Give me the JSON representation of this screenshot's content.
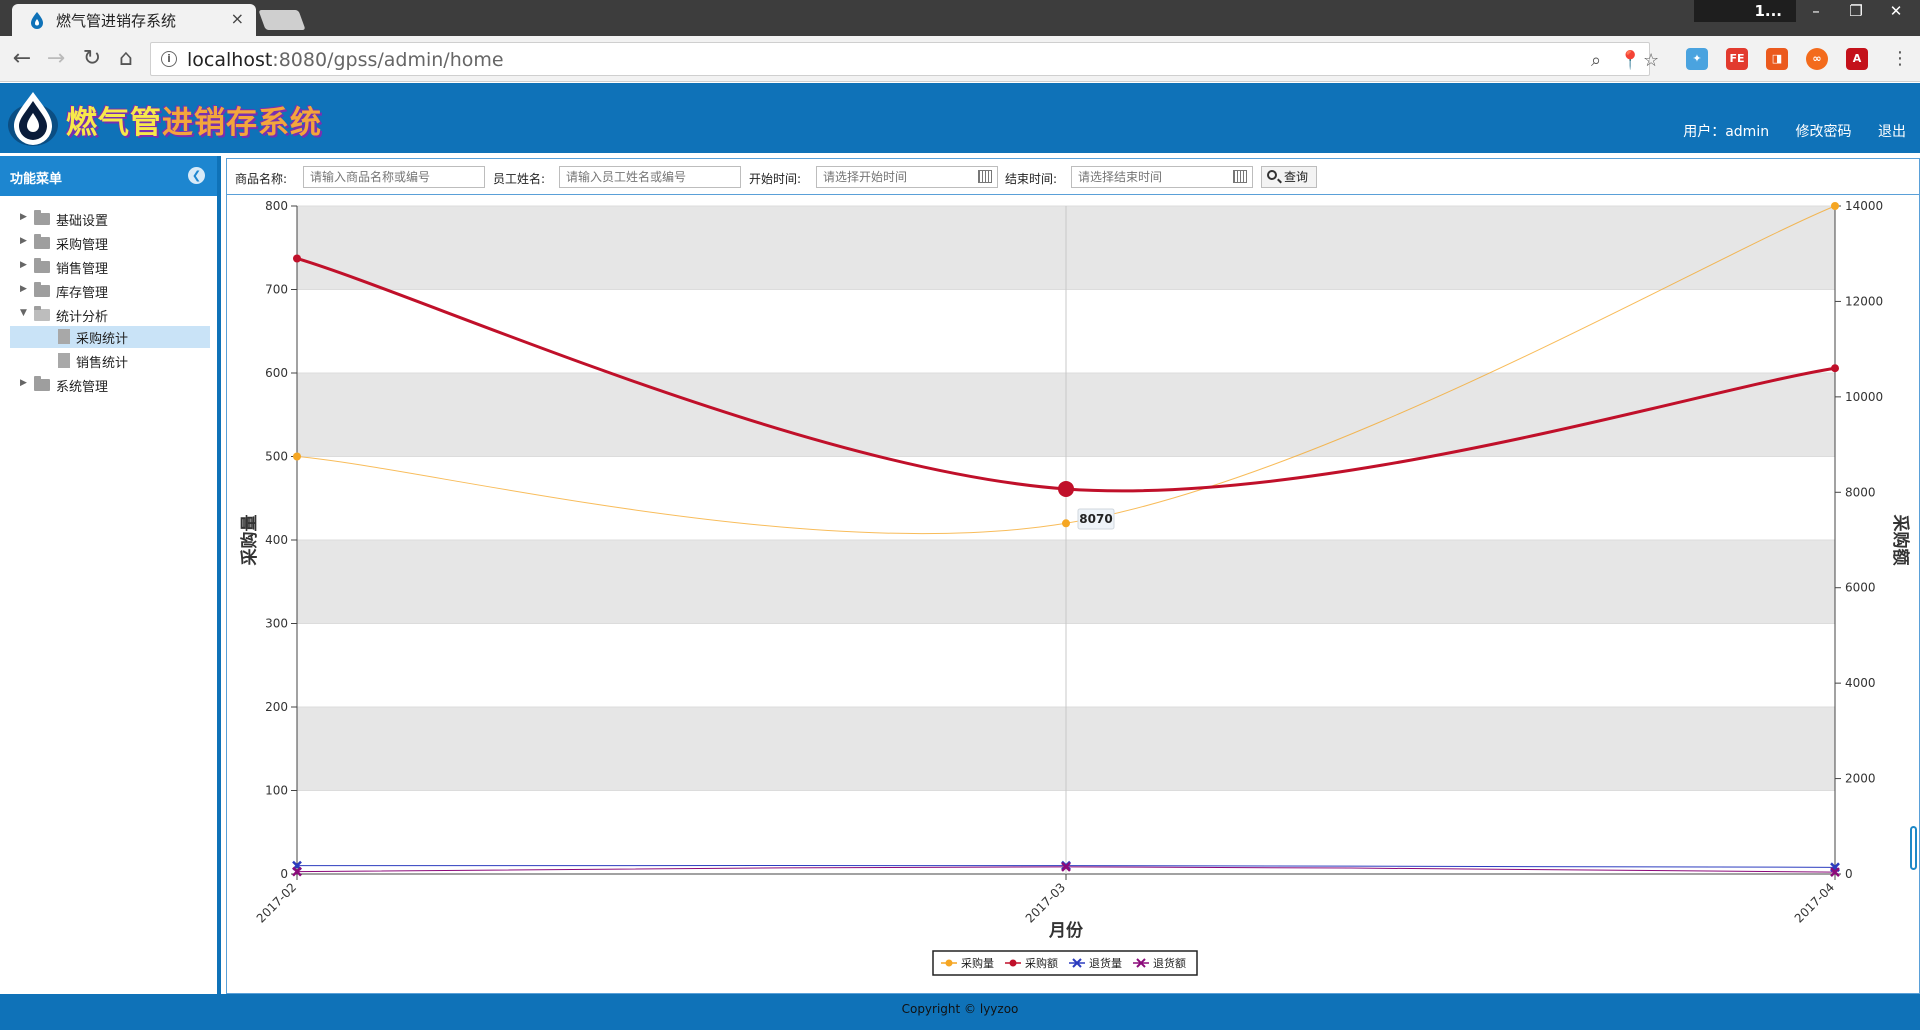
{
  "browser": {
    "tab_title": "燃气管进销存系统",
    "tab_close": "×",
    "window_user": "1...",
    "url_host": "localhost",
    "url_rest": ":8080/gpss/admin/home"
  },
  "app": {
    "title_part1": "燃气管",
    "title_part2": "进销存系统",
    "user_label": "用户：admin",
    "change_password": "修改密码",
    "logout": "退出"
  },
  "sidebar": {
    "title": "功能菜单",
    "items": [
      {
        "label": "基础设置"
      },
      {
        "label": "采购管理"
      },
      {
        "label": "销售管理"
      },
      {
        "label": "库存管理"
      },
      {
        "label": "统计分析"
      },
      {
        "label": "采购统计"
      },
      {
        "label": "销售统计"
      },
      {
        "label": "系统管理"
      }
    ]
  },
  "filters": {
    "product_label": "商品名称:",
    "product_placeholder": "请输入商品名称或编号",
    "employee_label": "员工姓名:",
    "employee_placeholder": "请输入员工姓名或编号",
    "start_label": "开始时间:",
    "start_placeholder": "请选择开始时间",
    "end_label": "结束时间:",
    "end_placeholder": "请选择结束时间",
    "query_label": "查询"
  },
  "chart_data": {
    "type": "line",
    "categories": [
      "2017-02",
      "2017-03",
      "2017-04"
    ],
    "xlabel": "月份",
    "ylabel_left": "采购量",
    "ylabel_right": "采购额",
    "ylim_left": [
      0,
      800
    ],
    "yticks_left": [
      0,
      100,
      200,
      300,
      400,
      500,
      600,
      700,
      800
    ],
    "ylim_right": [
      0,
      14000
    ],
    "yticks_right": [
      0,
      2000,
      4000,
      6000,
      8000,
      10000,
      12000,
      14000
    ],
    "series": [
      {
        "name": "采购量",
        "axis": "left",
        "values": [
          500,
          420,
          800
        ],
        "color": "#f5a623"
      },
      {
        "name": "采购额",
        "axis": "right",
        "values": [
          12900,
          8070,
          10600
        ],
        "color": "#c0102a"
      },
      {
        "name": "退货量",
        "axis": "left",
        "values": [
          10,
          10,
          8
        ],
        "color": "#2c3cbf"
      },
      {
        "name": "退货额",
        "axis": "right",
        "values": [
          50,
          150,
          40
        ],
        "color": "#8b0a7a"
      }
    ],
    "tooltip": {
      "series": "采购额",
      "category": "2017-03",
      "label": "8070"
    },
    "legend_position": "bottom-center",
    "banded_grid": true
  },
  "footer": {
    "copyright": "Copyright © lyyzoo"
  }
}
